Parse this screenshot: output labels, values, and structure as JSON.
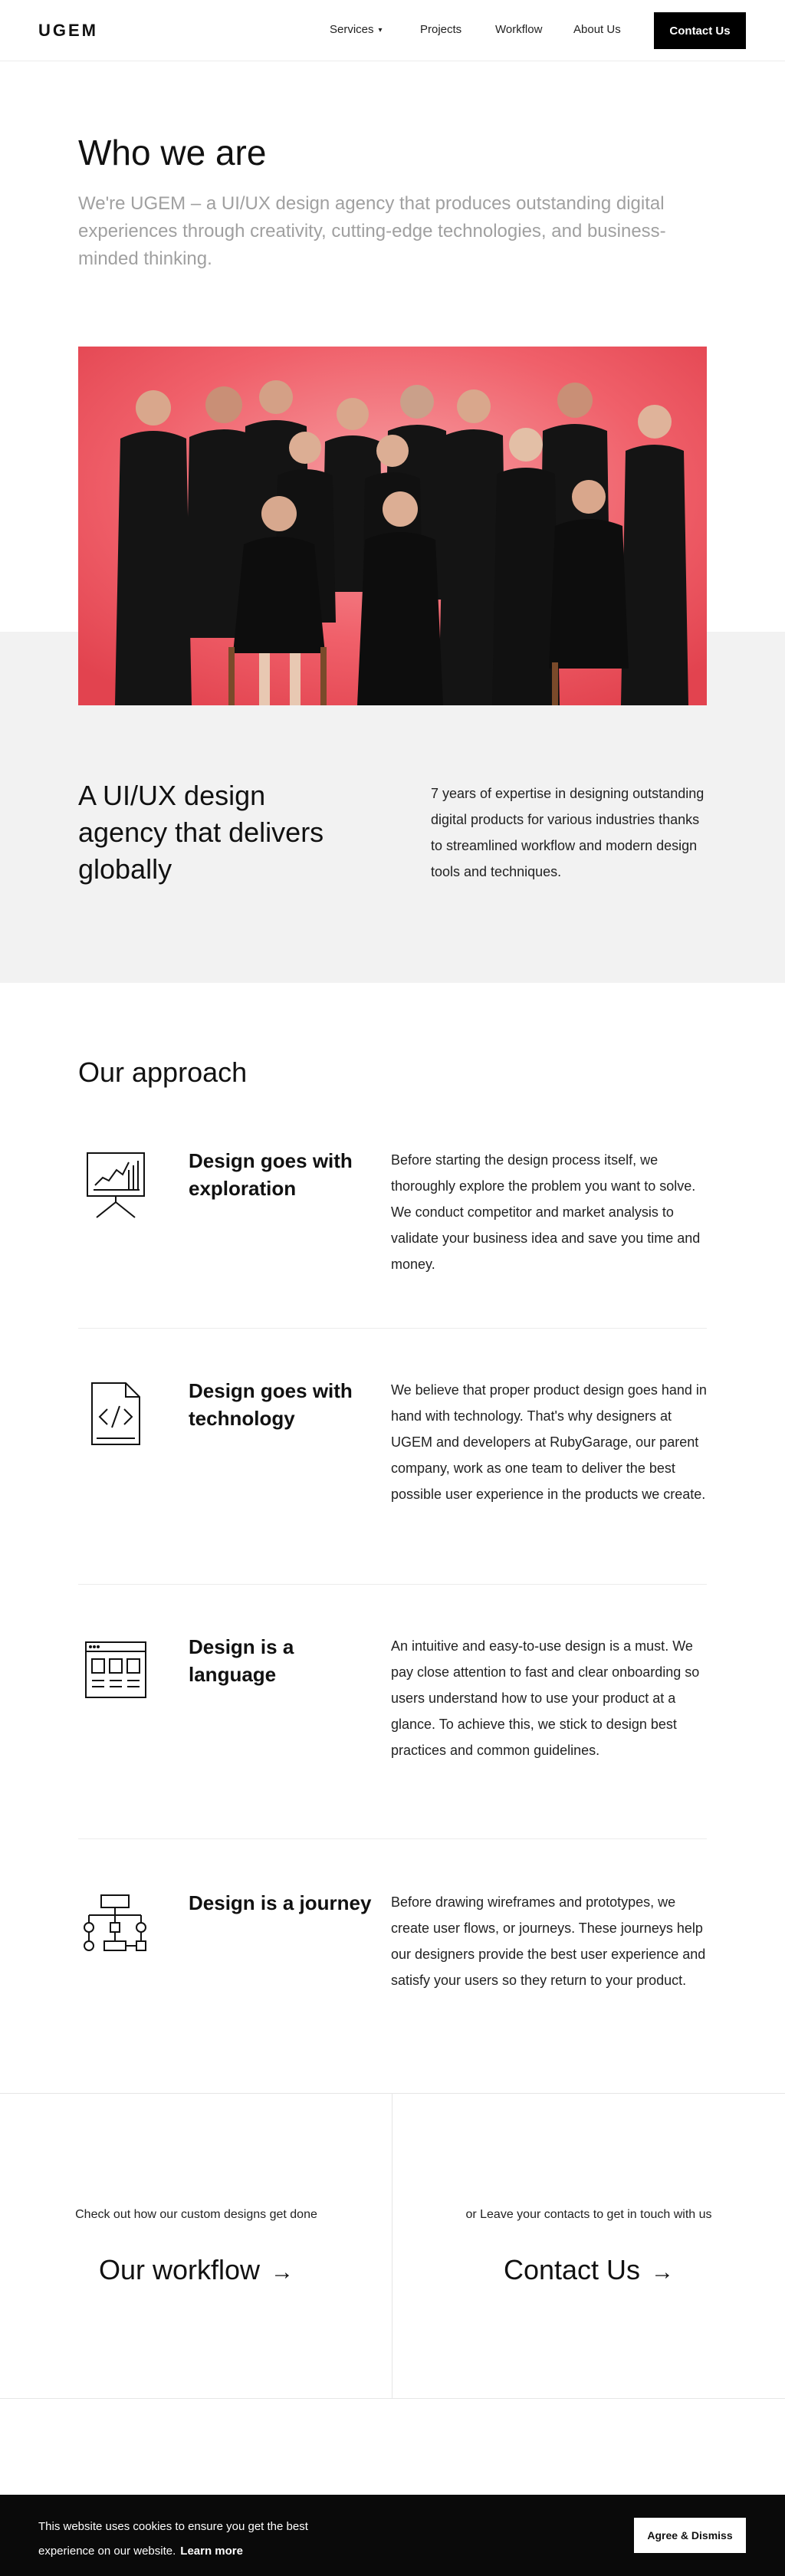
{
  "header": {
    "logo": "UGEM",
    "nav": {
      "services": "Services",
      "projects": "Projects",
      "workflow": "Workflow",
      "about": "About Us"
    },
    "contact_button": "Contact Us"
  },
  "who": {
    "title": "Who we are",
    "text": "We're UGEM – a UI/UX design agency that produces outstanding digital experiences through creativity, cutting-edge technologies, and business-minded thinking."
  },
  "global": {
    "title": "A UI/UX design agency that delivers globally",
    "text": "7 years of expertise in designing outstanding digital products for various industries thanks to streamlined workflow and modern design tools and techniques."
  },
  "approach": {
    "title": "Our approach",
    "items": [
      {
        "icon": "presentation-chart-icon",
        "heading": "Design goes with exploration",
        "body": "Before starting the design process itself, we thoroughly explore the problem you want to solve. We conduct competitor and market analysis to validate your business idea and save you time and money."
      },
      {
        "icon": "code-file-icon",
        "heading": "Design goes with technology",
        "body": "We believe that proper product design goes hand in hand with technology. That's why designers at UGEM and developers at RubyGarage, our parent company, work as one team to deliver the best possible user experience in the products we create."
      },
      {
        "icon": "browser-layout-icon",
        "heading": "Design is a language",
        "body": "An intuitive and easy-to-use design is a must. We pay close attention to fast and clear onboarding so users understand how to use your product at a glance. To achieve this, we stick to design best practices and common guidelines."
      },
      {
        "icon": "flowchart-icon",
        "heading": "Design is a journey",
        "body": "Before drawing wireframes and prototypes, we create user flows, or journeys. These journeys help our designers provide the best user experience and satisfy your users so they return to your product."
      }
    ]
  },
  "cta": {
    "left_sub": "Check out how our custom designs get done",
    "left_main": "Our workflow",
    "right_sub": "or Leave your contacts to get in touch with us",
    "right_main": "Contact Us",
    "arrow": "→"
  },
  "cookie": {
    "text": "This website uses cookies to ensure you get the best experience on our website.",
    "learn_more": "Learn more",
    "button": "Agree & Dismiss"
  },
  "colors": {
    "photo_bg": "#f0606a",
    "section_gray": "#f2f2f2",
    "muted_text": "#a0a0a0"
  }
}
